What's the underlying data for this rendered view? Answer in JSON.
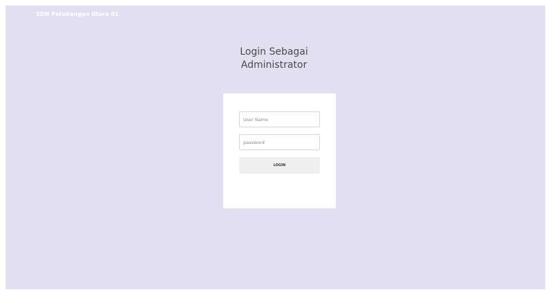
{
  "header": {
    "brand": "SDN Petukangan Utara 01"
  },
  "login": {
    "title_line1": "Login Sebagai",
    "title_line2": "Administrator",
    "username_placeholder": "User Name",
    "password_placeholder": "password",
    "button_label": "LOGIN"
  },
  "colors": {
    "background": "#e2e0f0",
    "card": "#ffffff",
    "button": "#efefef"
  }
}
